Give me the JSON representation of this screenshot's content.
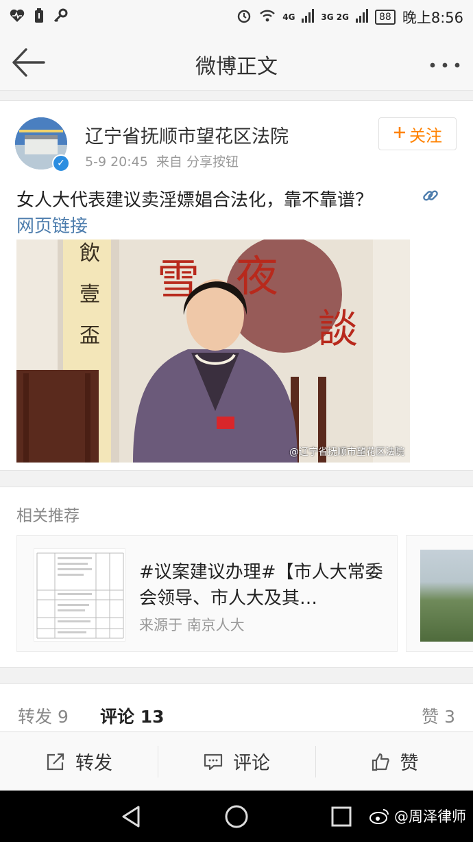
{
  "status_bar": {
    "network_4g": "4G",
    "network_3g": "3G 2G",
    "battery": "88",
    "time": "晚上8:56"
  },
  "nav": {
    "title": "微博正文"
  },
  "post": {
    "author": "辽宁省抚顺市望花区法院",
    "time": "5-9 20:45",
    "source": "来自 分享按钮",
    "follow_label": "关注",
    "text": "女人大代表建议卖淫嫖娼合法化，靠不靠谱？",
    "web_link_label": "网页链接",
    "image_watermark": "@辽宁省抚顺市望花区法院"
  },
  "recommendations": {
    "title": "相关推荐",
    "items": [
      {
        "headline": "#议案建议办理#【市人大常委会领导、市人大及其…",
        "source": "来源于 南京人大"
      }
    ]
  },
  "counts": {
    "repost": "转发 9",
    "comment": "评论 13",
    "like": "赞 3"
  },
  "actions": {
    "repost": "转发",
    "comment": "评论",
    "like": "赞"
  },
  "credit": "@周泽律师",
  "colors": {
    "accent_orange": "#ff8200",
    "link_blue": "#4d7dad",
    "verified_blue": "#2b8de0"
  }
}
